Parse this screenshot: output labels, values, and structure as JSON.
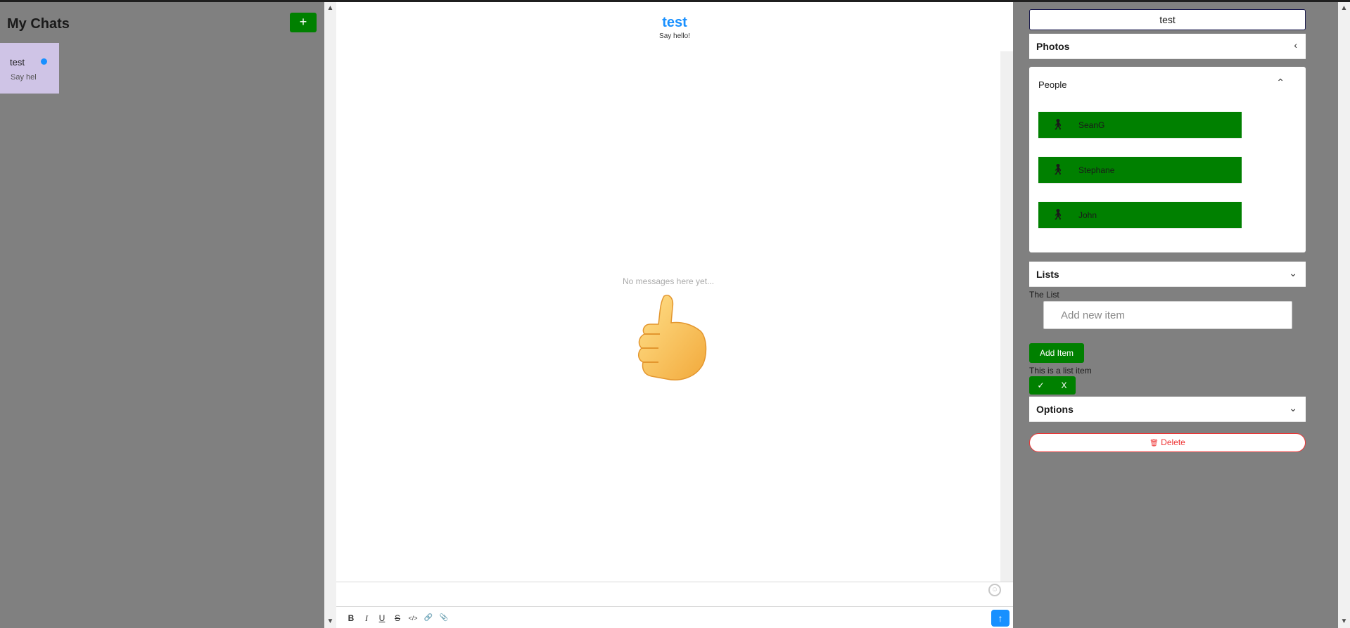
{
  "sidebar": {
    "title": "My Chats",
    "new_chat_label": "+",
    "chats": [
      {
        "title": "test",
        "preview": "Say hel"
      }
    ]
  },
  "chat": {
    "title": "test",
    "subtitle": "Say hello!",
    "empty_text": "No messages here yet...",
    "toolbar": {
      "bold": "B",
      "italic": "I",
      "underline": "U",
      "strike": "S",
      "code": "</>",
      "link": "🔗",
      "attach": "📎"
    },
    "send_label": "↑",
    "emoji_icon": "☺"
  },
  "settings": {
    "chat_title": "test",
    "sections": {
      "photos": "Photos",
      "people": "People",
      "lists": "Lists",
      "options": "Options"
    },
    "people": [
      "SeanG",
      "Stephane",
      "John"
    ],
    "list": {
      "title": "The List",
      "placeholder": "Add new item",
      "add_label": "Add Item",
      "items": [
        {
          "text": "This is a list item",
          "check_label": "✓",
          "remove_label": "X"
        }
      ]
    },
    "delete_label": "Delete",
    "delete_icon": "🗑"
  },
  "colors": {
    "accent_blue": "#1890ff",
    "green": "#008000",
    "danger": "#ee3333",
    "background": "#808080"
  },
  "icons": {
    "person": "person-icon",
    "chevron_left": "chevron-left-icon",
    "chevron_up": "chevron-up-icon",
    "chevron_down": "chevron-down-icon"
  }
}
